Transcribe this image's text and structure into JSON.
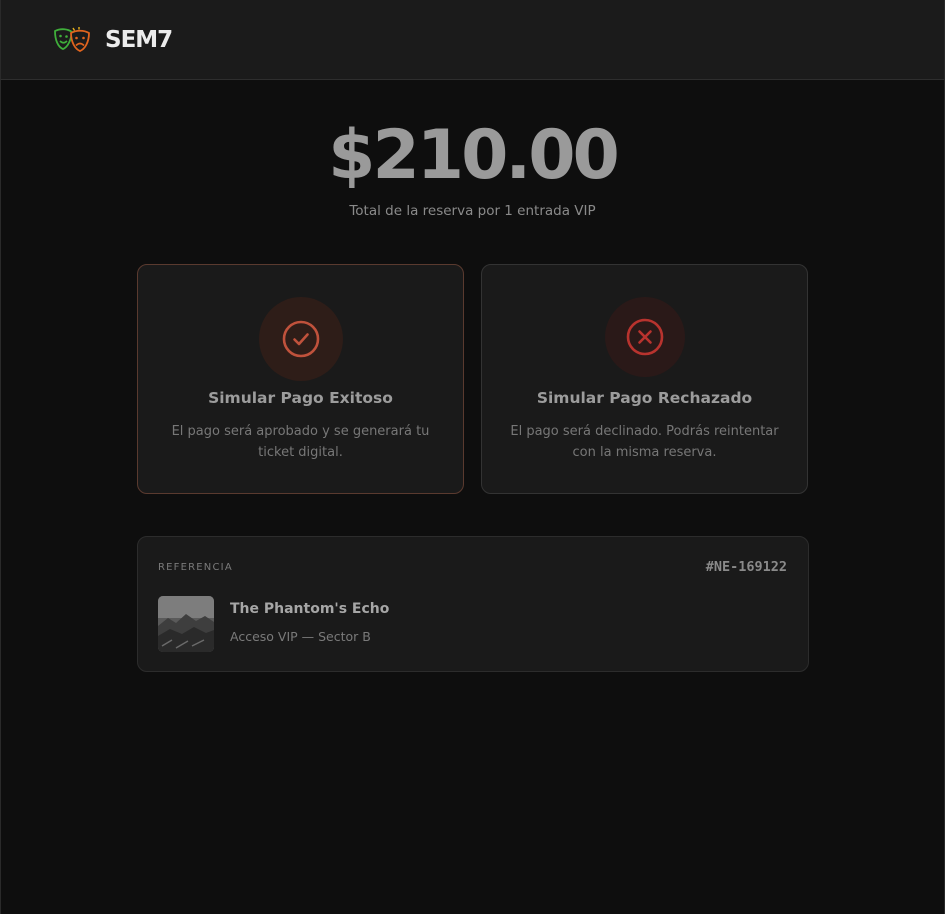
{
  "header": {
    "brand_name": "SEM7",
    "logo_icon": "theater-masks-icon"
  },
  "payment": {
    "amount": "$210.00",
    "description": "Total de la reserva por 1 entrada VIP"
  },
  "options": [
    {
      "title": "Simular Pago Exitoso",
      "description": "El pago será aprobado y se generará tu ticket digital.",
      "icon": "check-circle-icon",
      "accent_color": "#c0523c"
    },
    {
      "title": "Simular Pago Rechazado",
      "description": "El pago será declinado. Podrás reintentar con la misma reserva.",
      "icon": "x-circle-icon",
      "accent_color": "#b8332e"
    }
  ],
  "reference": {
    "label": "REFERENCIA",
    "code": "#NE-169122",
    "event_title": "The Phantom's Echo",
    "event_detail": "Acceso VIP — Sector B",
    "thumbnail": "event-thumbnail-image"
  }
}
